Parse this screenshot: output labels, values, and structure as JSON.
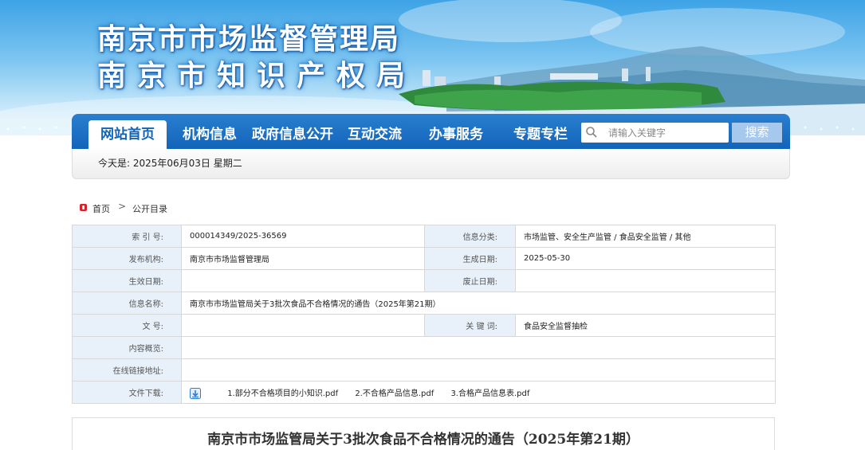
{
  "banner": {
    "title_line1": "南京市市场监督管理局",
    "title_line2": "南京市知识产权局"
  },
  "nav": {
    "items": [
      {
        "label": "网站首页",
        "active": true
      },
      {
        "label": "机构信息"
      },
      {
        "label": "政府信息公开"
      },
      {
        "label": "互动交流"
      },
      {
        "label": "办事服务"
      },
      {
        "label": "专题专栏"
      }
    ],
    "search_placeholder": "请输入关键字",
    "search_button": "搜索"
  },
  "datebar": {
    "text": "今天是:  2025年06月03日  星期二"
  },
  "breadcrumb": {
    "home": "首页",
    "separator": ">",
    "current": "公开目录"
  },
  "info": {
    "index_label": "索  引  号:",
    "index_value": "000014349/2025-36569",
    "category_label": "信息分类:",
    "category_value": "市场监管、安全生产监管 / 食品安全监管 / 其他",
    "publisher_label": "发布机构:",
    "publisher_value": "南京市市场监督管理局",
    "created_label": "生成日期:",
    "created_value": "2025-05-30",
    "effective_label": "生效日期:",
    "effective_value": "",
    "expire_label": "废止日期:",
    "expire_value": "",
    "name_label": "信息名称:",
    "name_value": "南京市市场监管局关于3批次食品不合格情况的通告（2025年第21期）",
    "docno_label": "文      号:",
    "docno_value": "",
    "keywords_label": "关  键  词:",
    "keywords_value": "食品安全监督抽检",
    "summary_label": "内容概览:",
    "summary_value": "",
    "online_label": "在线链接地址:",
    "online_value": "",
    "download_label": "文件下载:",
    "files": [
      "1.部分不合格项目的小知识.pdf",
      "2.不合格产品信息.pdf",
      "3.合格产品信息表.pdf"
    ]
  },
  "article": {
    "title": "南京市市场监管局关于3批次食品不合格情况的通告（2025年第21期）"
  },
  "colors": {
    "nav_blue": "#1264b8",
    "label_bg": "#e8f1fa",
    "home_red": "#d9222a"
  }
}
